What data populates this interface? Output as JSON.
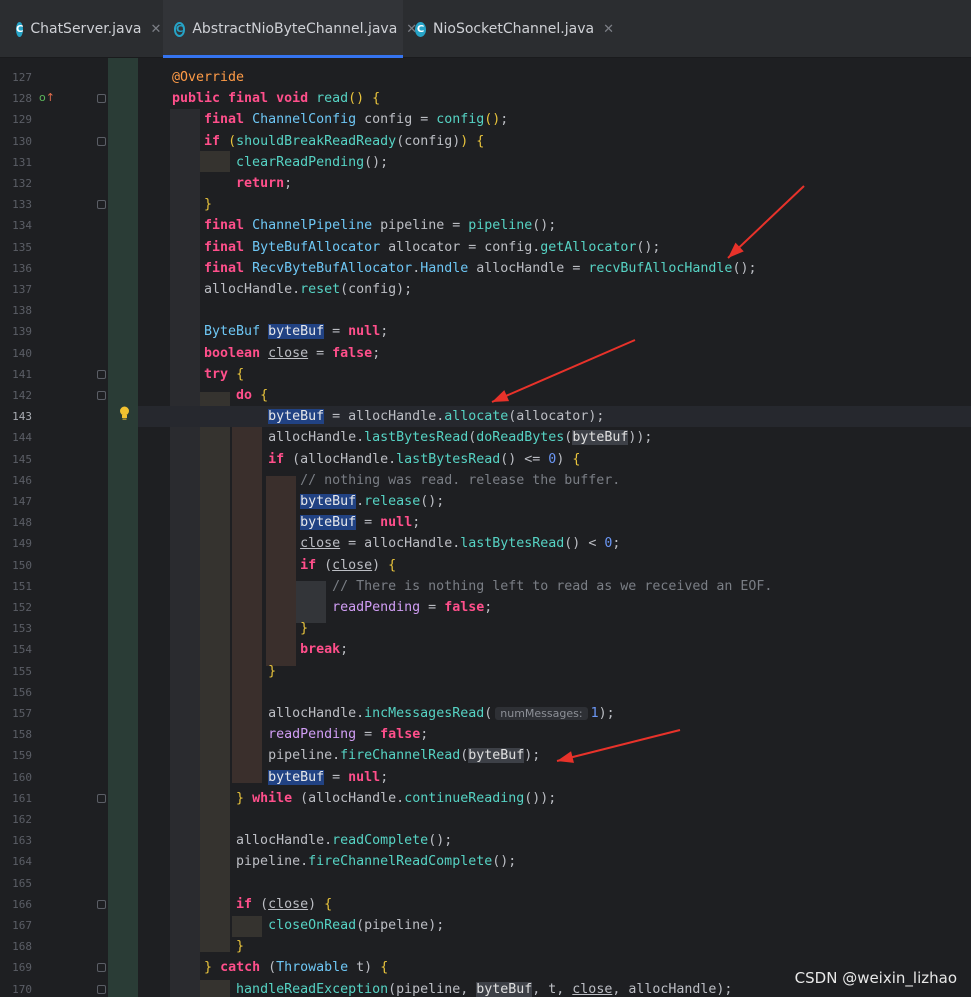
{
  "tabs": [
    {
      "label": "ChatServer.java",
      "icon": "class-icon"
    },
    {
      "label": "AbstractNioByteChannel.java",
      "icon": "abstract-class-icon",
      "active": true
    },
    {
      "label": "NioSocketChannel.java",
      "icon": "class-icon"
    }
  ],
  "editor": {
    "current_line": 143,
    "line_numbers": [
      "127",
      "128",
      "129",
      "130",
      "131",
      "132",
      "133",
      "134",
      "135",
      "136",
      "137",
      "138",
      "139",
      "140",
      "141",
      "142",
      "143",
      "144",
      "145",
      "146",
      "147",
      "148",
      "149",
      "150",
      "151",
      "152",
      "153",
      "154",
      "155",
      "156",
      "157",
      "158",
      "159",
      "160",
      "161",
      "162",
      "163",
      "164",
      "165",
      "166",
      "167",
      "168",
      "169",
      "170"
    ],
    "inlay_hint": "numMessages:",
    "comment_1": "// nothing was read. release the buffer.",
    "comment_2": "// There is nothing left to read as we received an EOF."
  },
  "watermark": "CSDN @weixin_lizhao",
  "colors": {
    "accent": "#3574f0",
    "arrow": "#e8322a",
    "background": "#1e1f22"
  }
}
